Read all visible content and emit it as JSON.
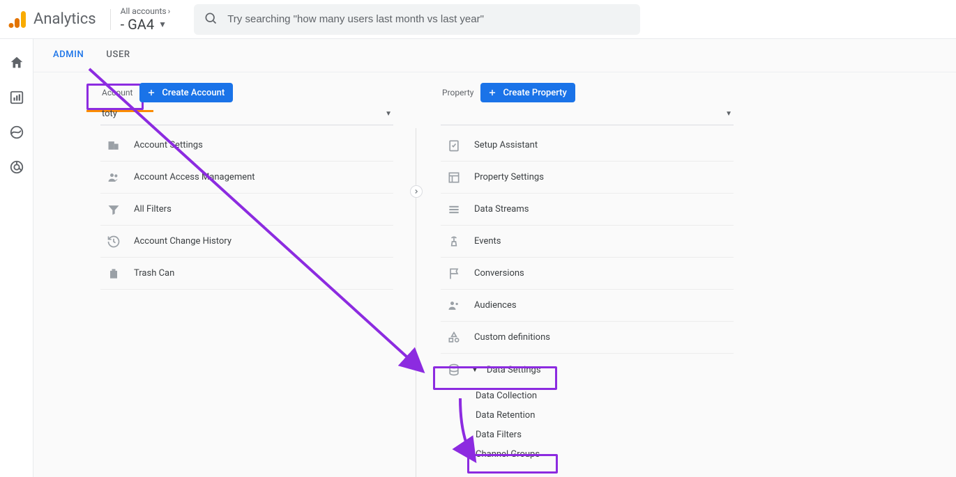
{
  "brand": {
    "name": "Analytics"
  },
  "breadcrumb": {
    "top": "All accounts",
    "bottom": " - GA4"
  },
  "search": {
    "placeholder": "Try searching \"how many users last month vs last year\""
  },
  "tabs": {
    "admin": "ADMIN",
    "user": "USER"
  },
  "account": {
    "label": "Account",
    "create": "Create Account",
    "selected": "toty",
    "items": [
      "Account Settings",
      "Account Access Management",
      "All Filters",
      "Account Change History",
      "Trash Can"
    ]
  },
  "property": {
    "label": "Property",
    "create": "Create Property",
    "selected": " ",
    "items": [
      "Setup Assistant",
      "Property Settings",
      "Data Streams",
      "Events",
      "Conversions",
      "Audiences",
      "Custom definitions"
    ],
    "data_settings": {
      "label": "Data Settings",
      "children": [
        "Data Collection",
        "Data Retention",
        "Data Filters",
        "Channel Groups"
      ]
    }
  }
}
